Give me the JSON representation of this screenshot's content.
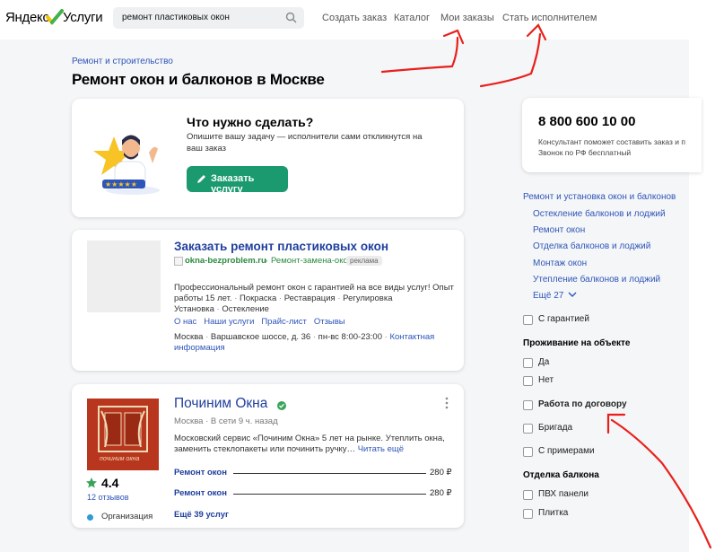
{
  "header": {
    "logo_part1": "Яндекс",
    "logo_part2": "Услуги",
    "search_value": "ремонт пластиковых окон",
    "nav": [
      "Создать заказ",
      "Каталог",
      "Мои заказы",
      "Стать исполнителем"
    ]
  },
  "page": {
    "breadcrumb": "Ремонт и строительство",
    "title": "Ремонт окон и балконов в Москве"
  },
  "promo": {
    "title": "Что нужно сделать?",
    "text_line1": "Опишите вашу задачу — исполнители сами откликнутся на",
    "text_line2": "ваш заказ",
    "button": "Заказать услугу"
  },
  "ad": {
    "title": "Заказать ремонт пластиковых окон",
    "domain": "okna-bezproblem.ru",
    "sep": "›",
    "path": "Ремонт-замена-окон",
    "badge": "реклама",
    "desc_line1": "Профессиональный ремонт окон с гарантией на все виды услуг! Опыт",
    "desc_line2": "работы 15 лет.",
    "tags_line2": [
      "Покраска",
      "Реставрация",
      "Регулировка"
    ],
    "tags_line3": [
      "Установка",
      "Остекление"
    ],
    "links": [
      "О нас",
      "Наши услуги",
      "Прайс-лист",
      "Отзывы"
    ],
    "city": "Москва",
    "address": "Варшавское шоссе, д. 36",
    "hours": "пн-вс 8:00-23:00",
    "contact_line1": "Контактная",
    "contact_line2": "информация"
  },
  "provider": {
    "logo_caption": "починим окна",
    "name": "Починим Окна",
    "city": "Москва",
    "online": "В сети 9 ч. назад",
    "desc_line1": "Московский сервис «Починим Окна» 5 лет на рынке. Утеплить окна,",
    "desc_line2": "заменить стеклопакеты или починить ручку…",
    "read_more": "Читать ещё",
    "rating": "4.4",
    "reviews": "12 отзывов",
    "org_label": "Организация",
    "prices": [
      {
        "service": "Ремонт окон",
        "price": "280 ₽"
      },
      {
        "service": "Ремонт окон",
        "price": "280 ₽"
      }
    ],
    "more": "Ещё 39 услуг"
  },
  "sidebar": {
    "phone": "8 800 600 10 00",
    "phone_note_line1": "Консультант поможет составить заказ и п",
    "phone_note_line2": "Звонок по РФ бесплатный",
    "category_main": "Ремонт и установка окон и балконов",
    "categories": [
      "Остекление балконов и лоджий",
      "Ремонт окон",
      "Отделка балконов и лоджий",
      "Монтаж окон",
      "Утепление балконов и лоджий"
    ],
    "more": "Ещё 27",
    "guarantee": "С гарантией",
    "living_heading": "Проживание на объекте",
    "living_yes": "Да",
    "living_no": "Нет",
    "contract": "Работа по договору",
    "team": "Бригада",
    "examples": "С примерами",
    "balcony_heading": "Отделка балкона",
    "pvc": "ПВХ панели",
    "tile": "Плитка"
  },
  "colors": {
    "accent_green": "#1a9a6e",
    "link_blue": "#2e55b8",
    "annotation_red": "#e8201c"
  }
}
